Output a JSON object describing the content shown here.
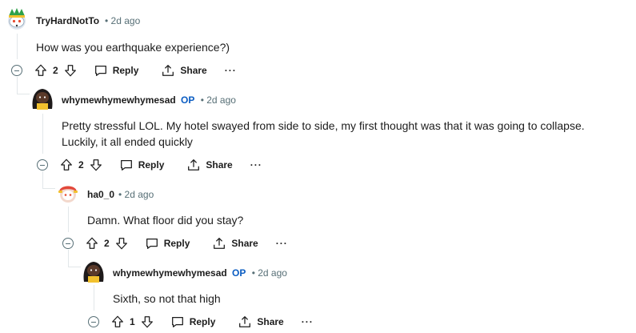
{
  "comments": [
    {
      "author": "TryHardNotTo",
      "op": false,
      "time": "2d ago",
      "text": [
        "How was you earthquake experience?)"
      ],
      "score": "2",
      "reply_label": "Reply",
      "share_label": "Share",
      "more_label": "···",
      "avatar": "snoo-avatar-green-hat-icon"
    },
    {
      "author": "whymewhymewhymesad",
      "op": true,
      "op_label": "OP",
      "time": "2d ago",
      "text": [
        "Pretty stressful LOL. My hotel swayed from side to side, my first thought was that it was going to collapse.",
        "Luckily, it all ended quickly"
      ],
      "score": "2",
      "reply_label": "Reply",
      "share_label": "Share",
      "more_label": "···",
      "avatar": "snoo-avatar-dark-hair-icon"
    },
    {
      "author": "ha0_0",
      "op": false,
      "time": "2d ago",
      "text": [
        "Damn. What floor did you stay?"
      ],
      "score": "2",
      "reply_label": "Reply",
      "share_label": "Share",
      "more_label": "···",
      "avatar": "snoo-avatar-red-hair-icon"
    },
    {
      "author": "whymewhymewhymesad",
      "op": true,
      "op_label": "OP",
      "time": "2d ago",
      "text": [
        "Sixth, so not that high"
      ],
      "score": "1",
      "reply_label": "Reply",
      "share_label": "Share",
      "more_label": "···",
      "avatar": "snoo-avatar-dark-hair-icon"
    }
  ],
  "separator": "•",
  "colors": {
    "meta": "#576f76",
    "op": "#0a5cc2",
    "thread_line": "#e2e7e9",
    "text": "#1c1c1c"
  }
}
